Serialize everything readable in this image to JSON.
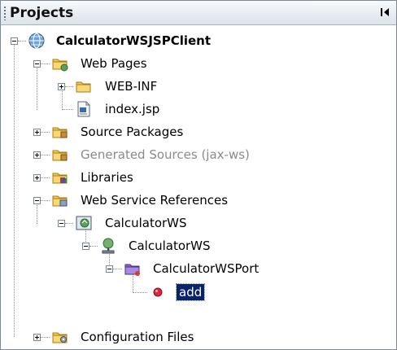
{
  "panel": {
    "title": "Projects",
    "minimize_icon": "minimize-arrow-icon"
  },
  "tree": {
    "project": "CalculatorWSJSPClient",
    "web_pages": "Web Pages",
    "web_inf": "WEB-INF",
    "index_jsp": "index.jsp",
    "source_packages": "Source Packages",
    "generated_sources": "Generated Sources (jax-ws)",
    "libraries": "Libraries",
    "web_service_references": "Web Service References",
    "calculator_ws_ref": "CalculatorWS",
    "calculator_ws_service": "CalculatorWS",
    "calculator_ws_port": "CalculatorWSPort",
    "add_operation": "add",
    "configuration_files": "Configuration Files"
  },
  "colors": {
    "selection": "#0a246a",
    "folder": "#f2c94c",
    "dim_text": "#8a8a8a",
    "header_gradient_top": "#f7f9fb",
    "header_gradient_bottom": "#dde3ea"
  }
}
